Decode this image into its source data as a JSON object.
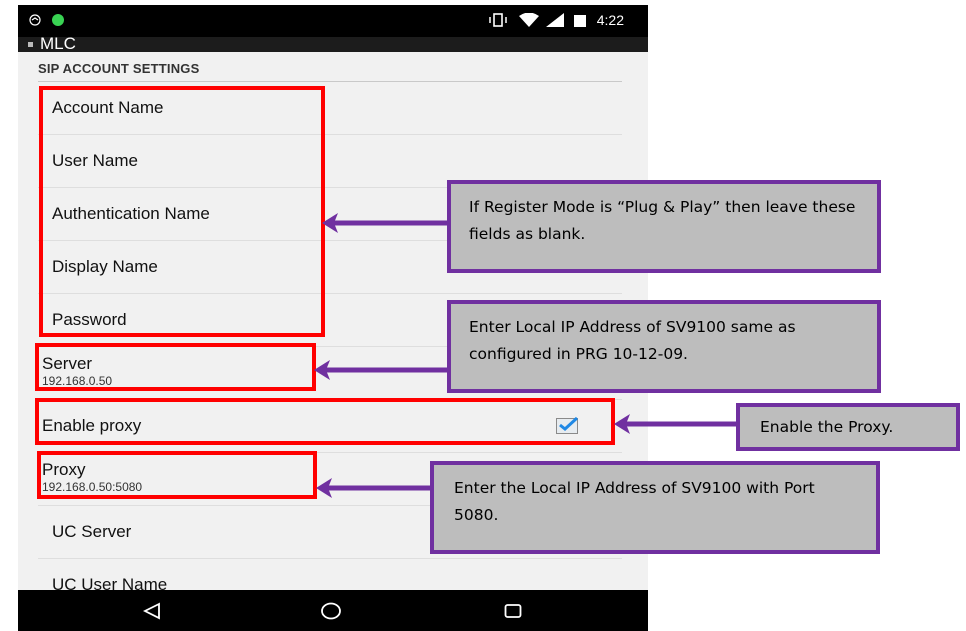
{
  "statusbar": {
    "time": "4:22"
  },
  "actionbar": {
    "title": "MLC"
  },
  "section": {
    "title": "SIP ACCOUNT SETTINGS"
  },
  "settings": {
    "account_name": "Account Name",
    "user_name": "User Name",
    "auth_name": "Authentication Name",
    "display_name": "Display Name",
    "password": "Password",
    "server_label": "Server",
    "server_value": "192.168.0.50",
    "enable_proxy": "Enable proxy",
    "enable_proxy_checked": true,
    "proxy_label": "Proxy",
    "proxy_value": "192.168.0.50:5080",
    "uc_server": "UC Server",
    "uc_user_name": "UC User Name"
  },
  "callouts": {
    "plug_play": "If Register Mode is “Plug & Play” then leave these fields as blank.",
    "server": "Enter Local IP Address of SV9100 same as configured in PRG 10-12-09.",
    "enable_proxy": "Enable the Proxy.",
    "proxy": "Enter the Local IP Address of SV9100 with Port 5080."
  },
  "colors": {
    "highlight": "#ff0000",
    "callout_border": "#7030a0",
    "callout_fill": "#bdbdbd",
    "checkmark": "#1e88e5"
  },
  "icons": [
    "notification-icon",
    "vibrate-icon",
    "wifi-icon",
    "signal-icon",
    "battery-icon",
    "back-icon",
    "home-icon",
    "recents-icon"
  ]
}
